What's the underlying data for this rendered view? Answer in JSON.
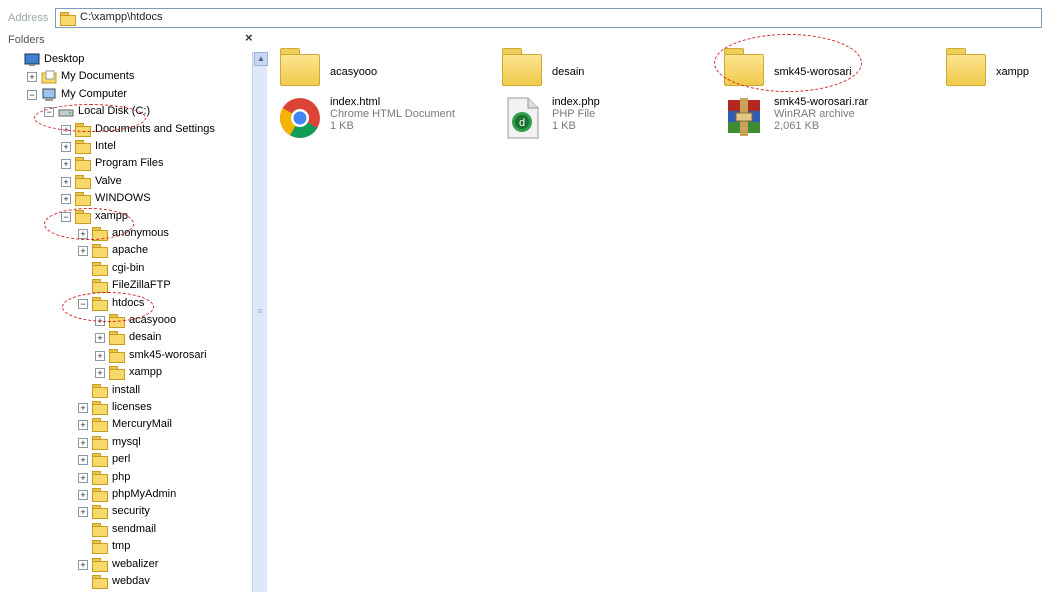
{
  "address": {
    "label": "Address",
    "path": "C:\\xampp\\htdocs"
  },
  "folders_pane": {
    "title": "Folders",
    "close": "×",
    "scroll_up": "▲",
    "scroll_grip": "≡",
    "tree": [
      {
        "label": "Desktop",
        "expander": ""
      },
      {
        "label": "My Documents",
        "expander": "+"
      },
      {
        "label": "My Computer",
        "expander": "−"
      },
      {
        "label": "Local Disk (C:)",
        "expander": "−"
      },
      {
        "label": "Documents and Settings",
        "expander": "+"
      },
      {
        "label": "Intel",
        "expander": "+"
      },
      {
        "label": "Program Files",
        "expander": "+"
      },
      {
        "label": "Valve",
        "expander": "+"
      },
      {
        "label": "WINDOWS",
        "expander": "+"
      },
      {
        "label": "xampp",
        "expander": "−"
      },
      {
        "label": "anonymous",
        "expander": "+"
      },
      {
        "label": "apache",
        "expander": "+"
      },
      {
        "label": "cgi-bin",
        "expander": ""
      },
      {
        "label": "FileZillaFTP",
        "expander": ""
      },
      {
        "label": "htdocs",
        "expander": "−"
      },
      {
        "label": "acasyooo",
        "expander": "+"
      },
      {
        "label": "desain",
        "expander": "+"
      },
      {
        "label": "smk45-worosari",
        "expander": "+"
      },
      {
        "label": "xampp",
        "expander": "+"
      },
      {
        "label": "install",
        "expander": ""
      },
      {
        "label": "licenses",
        "expander": "+"
      },
      {
        "label": "MercuryMail",
        "expander": "+"
      },
      {
        "label": "mysql",
        "expander": "+"
      },
      {
        "label": "perl",
        "expander": "+"
      },
      {
        "label": "php",
        "expander": "+"
      },
      {
        "label": "phpMyAdmin",
        "expander": "+"
      },
      {
        "label": "security",
        "expander": "+"
      },
      {
        "label": "sendmail",
        "expander": ""
      },
      {
        "label": "tmp",
        "expander": ""
      },
      {
        "label": "webalizer",
        "expander": "+"
      },
      {
        "label": "webdav",
        "expander": ""
      }
    ]
  },
  "content": {
    "folders": [
      {
        "name": "acasyooo"
      },
      {
        "name": "desain"
      },
      {
        "name": "smk45-worosari"
      },
      {
        "name": "xampp"
      }
    ],
    "files": [
      {
        "name": "index.html",
        "type": "Chrome HTML Document",
        "size": "1 KB",
        "icon": "chrome-icon"
      },
      {
        "name": "index.php",
        "type": "PHP File",
        "size": "1 KB",
        "icon": "php-file-icon"
      },
      {
        "name": "smk45-worosari.rar",
        "type": "WinRAR archive",
        "size": "2,061 KB",
        "icon": "winrar-icon"
      }
    ]
  }
}
